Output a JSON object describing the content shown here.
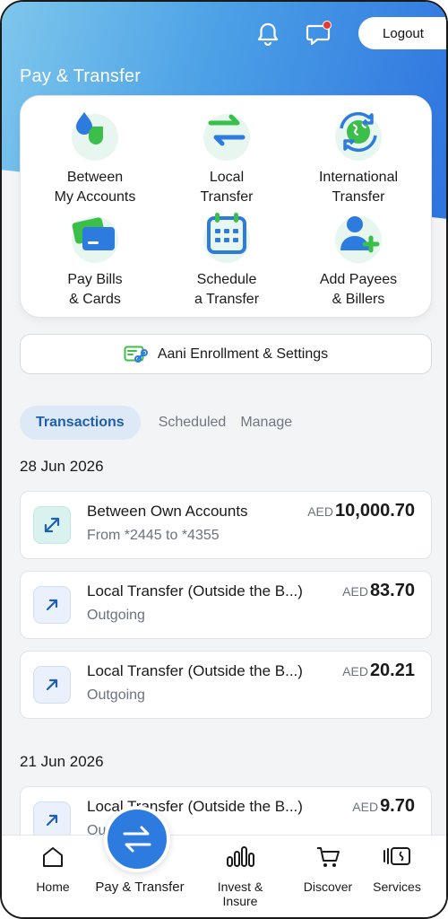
{
  "header": {
    "logout_label": "Logout",
    "title": "Pay & Transfer"
  },
  "quick_actions": [
    {
      "line1": "Between",
      "line2": "My Accounts"
    },
    {
      "line1": "Local",
      "line2": "Transfer"
    },
    {
      "line1": "International",
      "line2": "Transfer"
    },
    {
      "line1": "Pay Bills",
      "line2": "& Cards"
    },
    {
      "line1": "Schedule",
      "line2": "a Transfer"
    },
    {
      "line1": "Add Payees",
      "line2": "& Billers"
    }
  ],
  "aani": {
    "label": "Aani Enrollment & Settings"
  },
  "tabs": [
    {
      "label": "Transactions",
      "active": true
    },
    {
      "label": "Scheduled"
    },
    {
      "label": "Manage"
    }
  ],
  "groups": [
    {
      "date": "28 Jun 2026",
      "transactions": [
        {
          "title": "Between Own Accounts",
          "subtitle": "From *2445 to *4355",
          "currency": "AED",
          "amount": "10,000.70",
          "icon": "swap-arrows-icon"
        },
        {
          "title": "Local Transfer (Outside the B...)",
          "subtitle": "Outgoing",
          "currency": "AED",
          "amount": "83.70",
          "icon": "outgoing-arrow-icon"
        },
        {
          "title": "Local Transfer (Outside the B...)",
          "subtitle": "Outgoing",
          "currency": "AED",
          "amount": "20.21",
          "icon": "outgoing-arrow-icon"
        }
      ]
    },
    {
      "date": "21 Jun 2026",
      "transactions": [
        {
          "title": "Local Transfer (Outside the B...)",
          "subtitle": "Outgoing",
          "currency": "AED",
          "amount": "9.70",
          "icon": "outgoing-arrow-icon"
        }
      ]
    }
  ],
  "bottom_nav": {
    "home": "Home",
    "pay_transfer": "Pay & Transfer",
    "invest": "Invest & Insure",
    "discover": "Discover",
    "services": "Services"
  },
  "colors": {
    "accent": "#2e7be0",
    "green": "#3cbf4a",
    "tab_active_bg": "#dde9f7"
  }
}
